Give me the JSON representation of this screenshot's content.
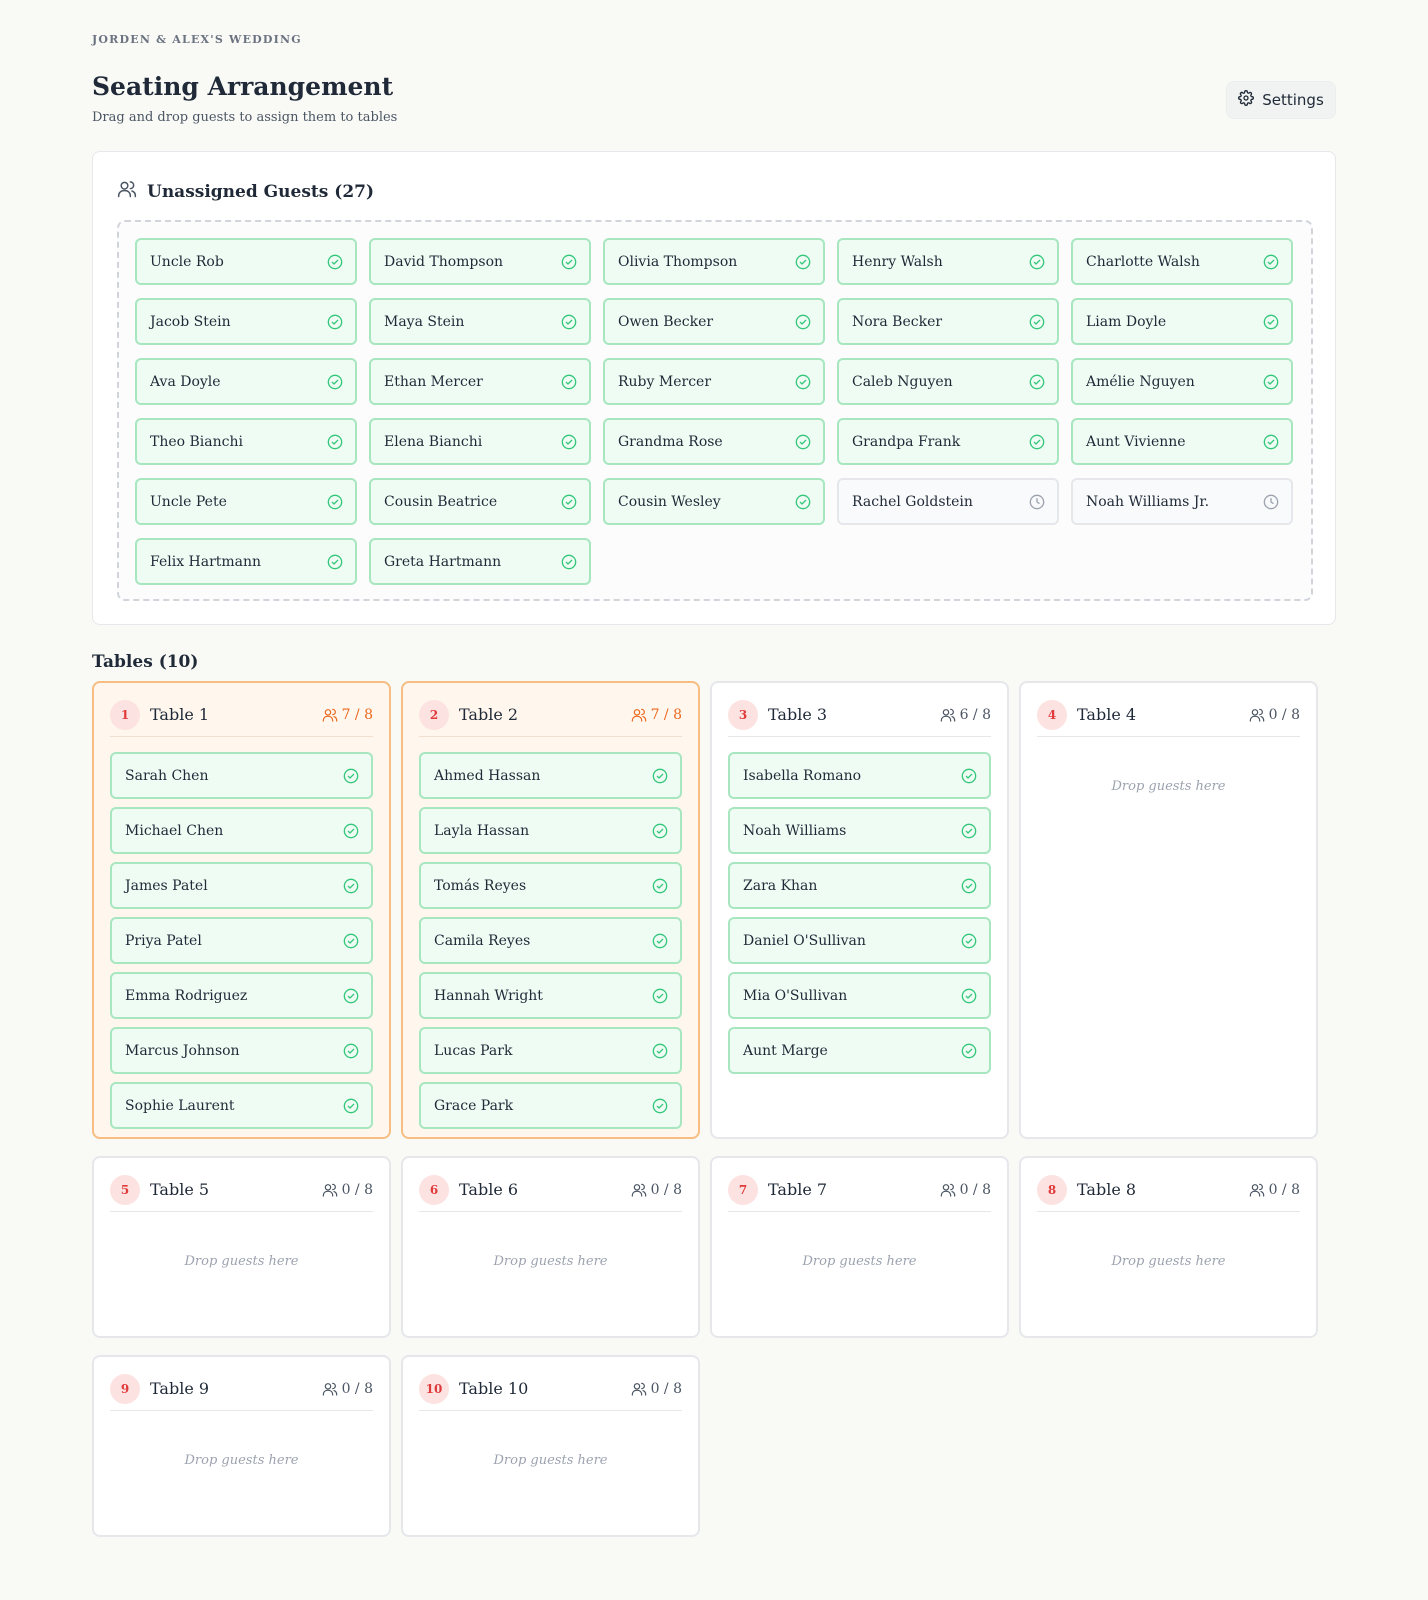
{
  "header": {
    "eyebrow": "JORDEN & ALEX'S WEDDING",
    "title": "Seating Arrangement",
    "subtitle": "Drag and drop guests to assign them to tables",
    "settings_label": "Settings"
  },
  "unassigned": {
    "title": "Unassigned Guests (27)",
    "guests": [
      {
        "name": "Uncle Rob",
        "status": "confirmed"
      },
      {
        "name": "David Thompson",
        "status": "confirmed"
      },
      {
        "name": "Olivia Thompson",
        "status": "confirmed"
      },
      {
        "name": "Henry Walsh",
        "status": "confirmed"
      },
      {
        "name": "Charlotte Walsh",
        "status": "confirmed"
      },
      {
        "name": "Jacob Stein",
        "status": "confirmed"
      },
      {
        "name": "Maya Stein",
        "status": "confirmed"
      },
      {
        "name": "Owen Becker",
        "status": "confirmed"
      },
      {
        "name": "Nora Becker",
        "status": "confirmed"
      },
      {
        "name": "Liam Doyle",
        "status": "confirmed"
      },
      {
        "name": "Ava Doyle",
        "status": "confirmed"
      },
      {
        "name": "Ethan Mercer",
        "status": "confirmed"
      },
      {
        "name": "Ruby Mercer",
        "status": "confirmed"
      },
      {
        "name": "Caleb Nguyen",
        "status": "confirmed"
      },
      {
        "name": "Amélie Nguyen",
        "status": "confirmed"
      },
      {
        "name": "Theo Bianchi",
        "status": "confirmed"
      },
      {
        "name": "Elena Bianchi",
        "status": "confirmed"
      },
      {
        "name": "Grandma Rose",
        "status": "confirmed"
      },
      {
        "name": "Grandpa Frank",
        "status": "confirmed"
      },
      {
        "name": "Aunt Vivienne",
        "status": "confirmed"
      },
      {
        "name": "Uncle Pete",
        "status": "confirmed"
      },
      {
        "name": "Cousin Beatrice",
        "status": "confirmed"
      },
      {
        "name": "Cousin Wesley",
        "status": "confirmed"
      },
      {
        "name": "Rachel Goldstein",
        "status": "pending"
      },
      {
        "name": "Noah Williams Jr.",
        "status": "pending"
      },
      {
        "name": "Felix Hartmann",
        "status": "confirmed"
      },
      {
        "name": "Greta Hartmann",
        "status": "confirmed"
      }
    ]
  },
  "tables_title": "Tables (10)",
  "drop_hint": "Drop guests here",
  "tables": [
    {
      "number": "1",
      "name": "Table 1",
      "count": "7 / 8",
      "full": true,
      "guests": [
        "Sarah Chen",
        "Michael Chen",
        "James Patel",
        "Priya Patel",
        "Emma Rodriguez",
        "Marcus Johnson",
        "Sophie Laurent"
      ]
    },
    {
      "number": "2",
      "name": "Table 2",
      "count": "7 / 8",
      "full": true,
      "guests": [
        "Ahmed Hassan",
        "Layla Hassan",
        "Tomás Reyes",
        "Camila Reyes",
        "Hannah Wright",
        "Lucas Park",
        "Grace Park"
      ]
    },
    {
      "number": "3",
      "name": "Table 3",
      "count": "6 / 8",
      "full": false,
      "guests": [
        "Isabella Romano",
        "Noah Williams",
        "Zara Khan",
        "Daniel O'Sullivan",
        "Mia O'Sullivan",
        "Aunt Marge"
      ]
    },
    {
      "number": "4",
      "name": "Table 4",
      "count": "0 / 8",
      "full": false,
      "guests": []
    },
    {
      "number": "5",
      "name": "Table 5",
      "count": "0 / 8",
      "full": false,
      "guests": []
    },
    {
      "number": "6",
      "name": "Table 6",
      "count": "0 / 8",
      "full": false,
      "guests": []
    },
    {
      "number": "7",
      "name": "Table 7",
      "count": "0 / 8",
      "full": false,
      "guests": []
    },
    {
      "number": "8",
      "name": "Table 8",
      "count": "0 / 8",
      "full": false,
      "guests": []
    },
    {
      "number": "9",
      "name": "Table 9",
      "count": "0 / 8",
      "full": false,
      "guests": []
    },
    {
      "number": "10",
      "name": "Table 10",
      "count": "0 / 8",
      "full": false,
      "guests": []
    }
  ],
  "colors": {
    "accent_orange": "#ea6a1e",
    "badge_red": "#e03b3b",
    "confirmed_green": "#34c77b",
    "pending_gray": "#9ca3af"
  }
}
